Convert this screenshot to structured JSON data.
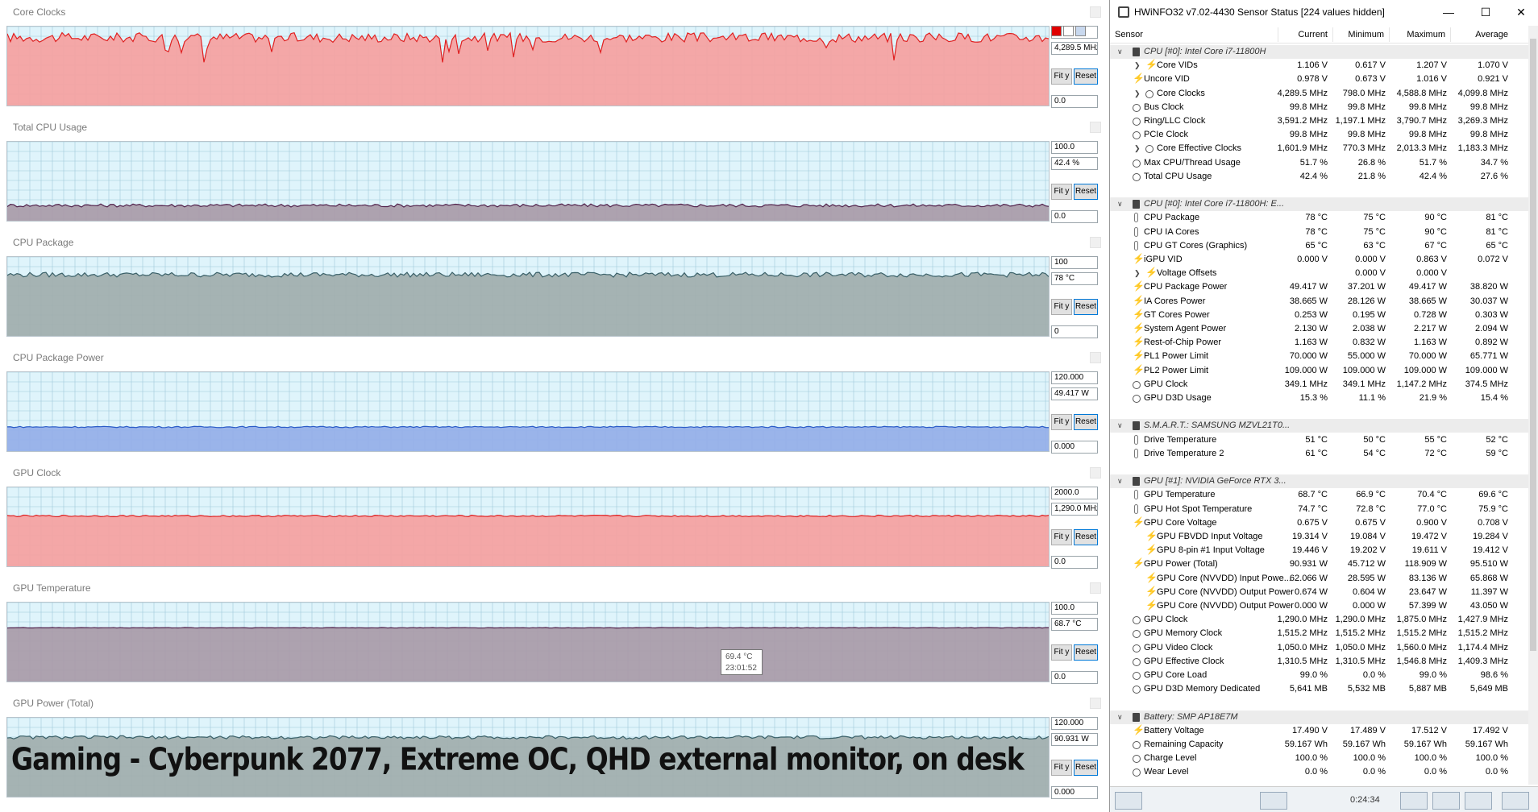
{
  "graphs": [
    {
      "title": "Core Clocks",
      "max": "",
      "current": "4,289.5 MHz",
      "min": "0.0",
      "fill": "#f5a0a0",
      "line": "#e02020",
      "level": 0.865,
      "noise": 0.06,
      "dips": true
    },
    {
      "title": "Total CPU Usage",
      "max": "100.0",
      "current": "42.4 %",
      "min": "0.0",
      "fill": "#a89aa8",
      "line": "#50204a",
      "level": 0.21,
      "noise": 0.02,
      "dips": false
    },
    {
      "title": "CPU Package",
      "max": "100",
      "current": "78 °C",
      "min": "0",
      "fill": "#a0acac",
      "line": "#3a6068",
      "level": 0.78,
      "noise": 0.03,
      "dips": false
    },
    {
      "title": "CPU Package Power",
      "max": "120.000",
      "current": "49.417 W",
      "min": "0.000",
      "fill": "#94aee8",
      "line": "#2a5cc8",
      "level": 0.32,
      "noise": 0.008,
      "dips": false
    },
    {
      "title": "GPU Clock",
      "max": "2000.0",
      "current": "1,290.0 MHz",
      "min": "0.0",
      "fill": "#f5a0a0",
      "line": "#e02020",
      "level": 0.645,
      "noise": 0.01,
      "dips": false
    },
    {
      "title": "GPU Temperature",
      "max": "100.0",
      "current": "68.7 °C",
      "min": "0.0",
      "fill": "#a89aa8",
      "line": "#50204a",
      "level": 0.687,
      "noise": 0.003,
      "dips": false
    },
    {
      "title": "GPU Power (Total)",
      "max": "120.000",
      "current": "90.931 W",
      "min": "0.000",
      "fill": "#a0acac",
      "line": "#3a6068",
      "level": 0.757,
      "noise": 0.02,
      "dips": false
    }
  ],
  "buttons": {
    "fit": "Fit y",
    "reset": "Reset"
  },
  "tooltip": {
    "value": "69.4 °C",
    "time": "23:01:52"
  },
  "caption": "Gaming - Cyberpunk 2077, Extreme OC, QHD external monitor, on desk",
  "hwinfo": {
    "title": "HWiNFO32 v7.02-4430 Sensor Status [224 values hidden]",
    "columns": {
      "sensor": "Sensor",
      "current": "Current",
      "minimum": "Minimum",
      "maximum": "Maximum",
      "average": "Average"
    },
    "footer_time": "0:24:34",
    "rows": [
      {
        "type": "group",
        "label": "CPU [#0]: Intel Core i7-11800H"
      },
      {
        "type": "item",
        "icon": "volt",
        "sub": true,
        "exp": true,
        "label": "Core VIDs",
        "cur": "1.106 V",
        "min": "0.617 V",
        "max": "1.207 V",
        "avg": "1.070 V"
      },
      {
        "type": "item",
        "icon": "volt",
        "label": "Uncore VID",
        "cur": "0.978 V",
        "min": "0.673 V",
        "max": "1.016 V",
        "avg": "0.921 V"
      },
      {
        "type": "item",
        "icon": "clock",
        "sub": true,
        "exp": true,
        "label": "Core Clocks",
        "cur": "4,289.5 MHz",
        "min": "798.0 MHz",
        "max": "4,588.8 MHz",
        "avg": "4,099.8 MHz"
      },
      {
        "type": "item",
        "icon": "clock",
        "label": "Bus Clock",
        "cur": "99.8 MHz",
        "min": "99.8 MHz",
        "max": "99.8 MHz",
        "avg": "99.8 MHz"
      },
      {
        "type": "item",
        "icon": "clock",
        "label": "Ring/LLC Clock",
        "cur": "3,591.2 MHz",
        "min": "1,197.1 MHz",
        "max": "3,790.7 MHz",
        "avg": "3,269.3 MHz"
      },
      {
        "type": "item",
        "icon": "clock",
        "label": "PCIe Clock",
        "cur": "99.8 MHz",
        "min": "99.8 MHz",
        "max": "99.8 MHz",
        "avg": "99.8 MHz"
      },
      {
        "type": "item",
        "icon": "clock",
        "sub": true,
        "exp": true,
        "label": "Core Effective Clocks",
        "cur": "1,601.9 MHz",
        "min": "770.3 MHz",
        "max": "2,013.3 MHz",
        "avg": "1,183.3 MHz"
      },
      {
        "type": "item",
        "icon": "clock",
        "label": "Max CPU/Thread Usage",
        "cur": "51.7 %",
        "min": "26.8 %",
        "max": "51.7 %",
        "avg": "34.7 %"
      },
      {
        "type": "item",
        "icon": "clock",
        "label": "Total CPU Usage",
        "cur": "42.4 %",
        "min": "21.8 %",
        "max": "42.4 %",
        "avg": "27.6 %"
      },
      {
        "type": "blank"
      },
      {
        "type": "group",
        "label": "CPU [#0]: Intel Core i7-11800H: E..."
      },
      {
        "type": "item",
        "icon": "therm",
        "label": "CPU Package",
        "cur": "78 °C",
        "min": "75 °C",
        "max": "90 °C",
        "avg": "81 °C"
      },
      {
        "type": "item",
        "icon": "therm",
        "label": "CPU IA Cores",
        "cur": "78 °C",
        "min": "75 °C",
        "max": "90 °C",
        "avg": "81 °C"
      },
      {
        "type": "item",
        "icon": "therm",
        "label": "CPU GT Cores (Graphics)",
        "cur": "65 °C",
        "min": "63 °C",
        "max": "67 °C",
        "avg": "65 °C"
      },
      {
        "type": "item",
        "icon": "volt",
        "label": "iGPU VID",
        "cur": "0.000 V",
        "min": "0.000 V",
        "max": "0.863 V",
        "avg": "0.072 V"
      },
      {
        "type": "item",
        "icon": "volt",
        "sub": true,
        "exp": true,
        "label": "Voltage Offsets",
        "cur": "",
        "min": "0.000 V",
        "max": "0.000 V",
        "avg": ""
      },
      {
        "type": "item",
        "icon": "volt",
        "label": "CPU Package Power",
        "cur": "49.417 W",
        "min": "37.201 W",
        "max": "49.417 W",
        "avg": "38.820 W"
      },
      {
        "type": "item",
        "icon": "volt",
        "label": "IA Cores Power",
        "cur": "38.665 W",
        "min": "28.126 W",
        "max": "38.665 W",
        "avg": "30.037 W"
      },
      {
        "type": "item",
        "icon": "volt",
        "label": "GT Cores Power",
        "cur": "0.253 W",
        "min": "0.195 W",
        "max": "0.728 W",
        "avg": "0.303 W"
      },
      {
        "type": "item",
        "icon": "volt",
        "label": "System Agent Power",
        "cur": "2.130 W",
        "min": "2.038 W",
        "max": "2.217 W",
        "avg": "2.094 W"
      },
      {
        "type": "item",
        "icon": "volt",
        "label": "Rest-of-Chip Power",
        "cur": "1.163 W",
        "min": "0.832 W",
        "max": "1.163 W",
        "avg": "0.892 W"
      },
      {
        "type": "item",
        "icon": "volt",
        "label": "PL1 Power Limit",
        "cur": "70.000 W",
        "min": "55.000 W",
        "max": "70.000 W",
        "avg": "65.771 W"
      },
      {
        "type": "item",
        "icon": "volt",
        "label": "PL2 Power Limit",
        "cur": "109.000 W",
        "min": "109.000 W",
        "max": "109.000 W",
        "avg": "109.000 W"
      },
      {
        "type": "item",
        "icon": "clock",
        "label": "GPU Clock",
        "cur": "349.1 MHz",
        "min": "349.1 MHz",
        "max": "1,147.2 MHz",
        "avg": "374.5 MHz"
      },
      {
        "type": "item",
        "icon": "clock",
        "label": "GPU D3D Usage",
        "cur": "15.3 %",
        "min": "11.1 %",
        "max": "21.9 %",
        "avg": "15.4 %"
      },
      {
        "type": "blank"
      },
      {
        "type": "group",
        "label": "S.M.A.R.T.: SAMSUNG MZVL21T0..."
      },
      {
        "type": "item",
        "icon": "therm",
        "label": "Drive Temperature",
        "cur": "51 °C",
        "min": "50 °C",
        "max": "55 °C",
        "avg": "52 °C"
      },
      {
        "type": "item",
        "icon": "therm",
        "label": "Drive Temperature 2",
        "cur": "61 °C",
        "min": "54 °C",
        "max": "72 °C",
        "avg": "59 °C"
      },
      {
        "type": "blank"
      },
      {
        "type": "group",
        "label": "GPU [#1]: NVIDIA GeForce RTX 3..."
      },
      {
        "type": "item",
        "icon": "therm",
        "label": "GPU Temperature",
        "cur": "68.7 °C",
        "min": "66.9 °C",
        "max": "70.4 °C",
        "avg": "69.6 °C"
      },
      {
        "type": "item",
        "icon": "therm",
        "label": "GPU Hot Spot Temperature",
        "cur": "74.7 °C",
        "min": "72.8 °C",
        "max": "77.0 °C",
        "avg": "75.9 °C"
      },
      {
        "type": "item",
        "icon": "volt",
        "label": "GPU Core Voltage",
        "cur": "0.675 V",
        "min": "0.675 V",
        "max": "0.900 V",
        "avg": "0.708 V"
      },
      {
        "type": "item",
        "icon": "volt",
        "sub": true,
        "label": "GPU FBVDD Input Voltage",
        "cur": "19.314 V",
        "min": "19.084 V",
        "max": "19.472 V",
        "avg": "19.284 V"
      },
      {
        "type": "item",
        "icon": "volt",
        "sub": true,
        "label": "GPU 8-pin #1 Input Voltage",
        "cur": "19.446 V",
        "min": "19.202 V",
        "max": "19.611 V",
        "avg": "19.412 V"
      },
      {
        "type": "item",
        "icon": "volt",
        "label": "GPU Power (Total)",
        "cur": "90.931 W",
        "min": "45.712 W",
        "max": "118.909 W",
        "avg": "95.510 W"
      },
      {
        "type": "item",
        "icon": "volt",
        "sub": true,
        "label": "GPU Core (NVVDD) Input Powe...",
        "cur": "62.066 W",
        "min": "28.595 W",
        "max": "83.136 W",
        "avg": "65.868 W"
      },
      {
        "type": "item",
        "icon": "volt",
        "sub": true,
        "label": "GPU Core (NVVDD) Output Power",
        "cur": "0.674 W",
        "min": "0.604 W",
        "max": "23.647 W",
        "avg": "11.397 W"
      },
      {
        "type": "item",
        "icon": "volt",
        "sub": true,
        "label": "GPU Core (NVVDD) Output Power",
        "cur": "0.000 W",
        "min": "0.000 W",
        "max": "57.399 W",
        "avg": "43.050 W"
      },
      {
        "type": "item",
        "icon": "clock",
        "label": "GPU Clock",
        "cur": "1,290.0 MHz",
        "min": "1,290.0 MHz",
        "max": "1,875.0 MHz",
        "avg": "1,427.9 MHz"
      },
      {
        "type": "item",
        "icon": "clock",
        "label": "GPU Memory Clock",
        "cur": "1,515.2 MHz",
        "min": "1,515.2 MHz",
        "max": "1,515.2 MHz",
        "avg": "1,515.2 MHz"
      },
      {
        "type": "item",
        "icon": "clock",
        "label": "GPU Video Clock",
        "cur": "1,050.0 MHz",
        "min": "1,050.0 MHz",
        "max": "1,560.0 MHz",
        "avg": "1,174.4 MHz"
      },
      {
        "type": "item",
        "icon": "clock",
        "label": "GPU Effective Clock",
        "cur": "1,310.5 MHz",
        "min": "1,310.5 MHz",
        "max": "1,546.8 MHz",
        "avg": "1,409.3 MHz"
      },
      {
        "type": "item",
        "icon": "clock",
        "label": "GPU Core Load",
        "cur": "99.0 %",
        "min": "0.0 %",
        "max": "99.0 %",
        "avg": "98.6 %"
      },
      {
        "type": "item",
        "icon": "clock",
        "label": "GPU D3D Memory Dedicated",
        "cur": "5,641 MB",
        "min": "5,532 MB",
        "max": "5,887 MB",
        "avg": "5,649 MB"
      },
      {
        "type": "blank"
      },
      {
        "type": "group",
        "label": "Battery: SMP  AP18E7M"
      },
      {
        "type": "item",
        "icon": "volt",
        "label": "Battery Voltage",
        "cur": "17.490 V",
        "min": "17.489 V",
        "max": "17.512 V",
        "avg": "17.492 V"
      },
      {
        "type": "item",
        "icon": "clock",
        "label": "Remaining Capacity",
        "cur": "59.167 Wh",
        "min": "59.167 Wh",
        "max": "59.167 Wh",
        "avg": "59.167 Wh"
      },
      {
        "type": "item",
        "icon": "clock",
        "label": "Charge Level",
        "cur": "100.0 %",
        "min": "100.0 %",
        "max": "100.0 %",
        "avg": "100.0 %"
      },
      {
        "type": "item",
        "icon": "clock",
        "label": "Wear Level",
        "cur": "0.0 %",
        "min": "0.0 %",
        "max": "0.0 %",
        "avg": "0.0 %"
      }
    ]
  }
}
